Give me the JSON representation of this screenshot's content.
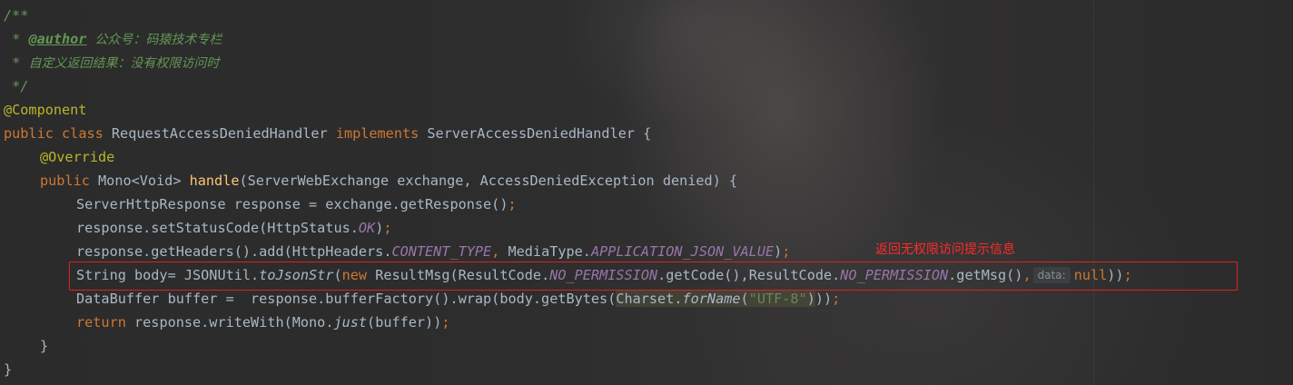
{
  "code": {
    "doc_open": "/**",
    "doc_star": " * ",
    "doc_author_tag": "@author",
    "doc_author_text": "  公众号：码猿技术专栏",
    "doc_desc": "自定义返回结果：没有权限访问时",
    "doc_close": " */",
    "annotation_component": "@Component",
    "kw_public": "public",
    "kw_class": "class",
    "class_name": "RequestAccessDeniedHandler",
    "kw_implements": "implements",
    "interface_name": "ServerAccessDeniedHandler",
    "brace_open": " {",
    "annotation_override": "@Override",
    "return_type": "Mono<Void>",
    "method_name": "handle",
    "params": "(ServerWebExchange exchange, AccessDeniedException denied) {",
    "line_response": "ServerHttpResponse response = exchange.getResponse()",
    "semicolon": ";",
    "line_status_a": "response.setStatusCode(HttpStatus.",
    "const_ok": "OK",
    "line_status_b": ")",
    "line_headers_a": "response.getHeaders().add(HttpHeaders.",
    "const_content_type": "CONTENT_TYPE",
    "comma": ",",
    "line_headers_b": " MediaType.",
    "const_app_json": "APPLICATION_JSON_VALUE",
    "line_headers_c": ")",
    "line_body_a": "String body= JSONUtil.",
    "fn_to_json": "toJsonStr",
    "paren_open": "(",
    "kw_new": "new",
    "line_body_b": " ResultMsg(ResultCode.",
    "const_no_permission": "NO_PERMISSION",
    "line_body_c": ".getCode(),ResultCode.",
    "line_body_d": ".getMsg()",
    "hint_data": "data:",
    "kw_null": "null",
    "line_body_e": "))",
    "line_buffer_a": "DataBuffer buffer =  response.bufferFactory().wrap(body.getBytes(",
    "line_buffer_b": "Charset.",
    "fn_for_name": "forName",
    "str_utf8": "\"UTF-8\"",
    "line_buffer_c": ")",
    "line_buffer_d": "))",
    "kw_return": "return",
    "line_return_a": " response.writeWith(Mono.",
    "fn_just": "just",
    "line_return_b": "(buffer))",
    "brace_close": "}"
  },
  "annotation_note": "返回无权限访问提示信息",
  "colors": {
    "keyword": "#cc7832",
    "annotation": "#bbb529",
    "doc_comment": "#629755",
    "method_decl": "#ffc66d",
    "constant": "#9876aa",
    "string": "#6a8759",
    "default_text": "#a9b7c6",
    "callout_border": "#e02020",
    "callout_text": "#ff2a2a"
  }
}
